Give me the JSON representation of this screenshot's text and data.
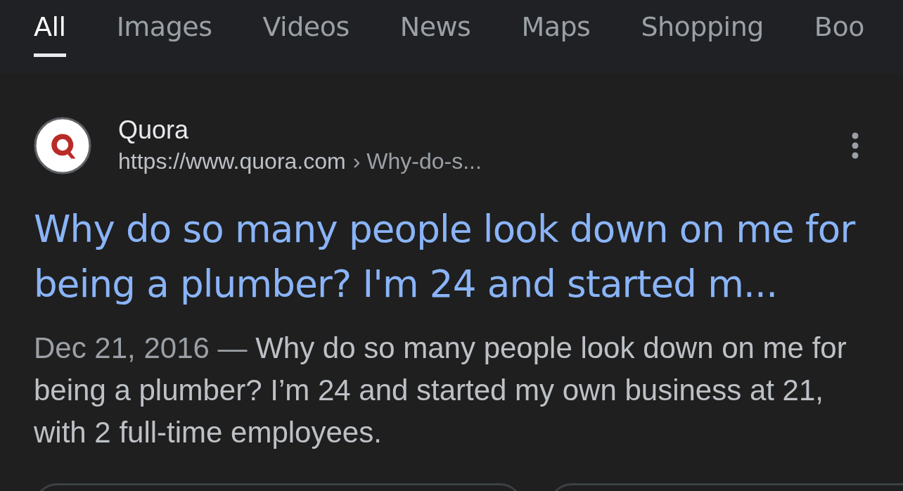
{
  "tabs": [
    {
      "label": "All",
      "selected": true
    },
    {
      "label": "Images",
      "selected": false
    },
    {
      "label": "Videos",
      "selected": false
    },
    {
      "label": "News",
      "selected": false
    },
    {
      "label": "Maps",
      "selected": false
    },
    {
      "label": "Shopping",
      "selected": false
    },
    {
      "label": "Boo",
      "selected": false
    }
  ],
  "result": {
    "site": "Quora",
    "url": "https://www.quora.com",
    "path": "› Why-do-s...",
    "title": "Why do so many people look down on me for being a plumber? I'm 24 and started m...",
    "date": "Dec 21, 2016 —",
    "snippet": "Why do so many people look down on me for being a plumber? I’m 24 and started my own business at 21, with 2 full-time employees."
  }
}
